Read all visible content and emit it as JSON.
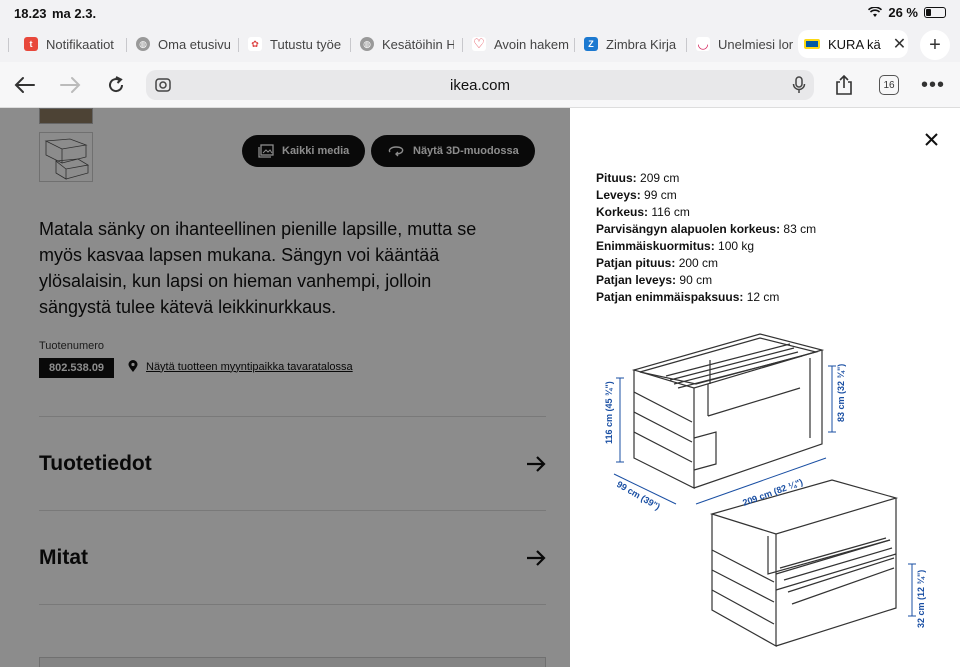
{
  "status": {
    "time": "18.23",
    "date": "ma 2.3.",
    "battery": "26 %",
    "battery_level": 0.26
  },
  "tabs": [
    {
      "label": "Notifikaatiot",
      "icon": "tori-icon",
      "color": "#e8483b"
    },
    {
      "label": "Oma etusivu",
      "icon": "globe-icon",
      "color": "#888888"
    },
    {
      "label": "Tutustu työe",
      "icon": "butterfly-icon",
      "color": "#d44"
    },
    {
      "label": "Kesätöihin H",
      "icon": "globe-icon",
      "color": "#888888"
    },
    {
      "label": "Avoin hakem",
      "icon": "heart-icon",
      "color": "#e03040"
    },
    {
      "label": "Zimbra Kirja",
      "icon": "zimbra-icon",
      "color": "#1c79d0"
    },
    {
      "label": "Unelmiesi lor",
      "icon": "smile-icon",
      "color": "#d6205a"
    },
    {
      "label": "KURA kä",
      "icon": "ikea-icon",
      "color": "#0058a3"
    }
  ],
  "address": {
    "url": "ikea.com"
  },
  "toolbar": {
    "tab_count": "16"
  },
  "page": {
    "media_button": "Kaikki media",
    "view3d_button": "Näytä 3D-muodossa",
    "description": "Matala sänky on ihanteellinen pienille lapsille, mutta se myös kasvaa lapsen mukana. Sängyn voi kääntää ylösalaisin, kun lapsi on hieman vanhempi, jolloin sängystä tulee kätevä leikkinurkkaus.",
    "product_number_label": "Tuotenumero",
    "product_number": "802.538.09",
    "store_link": "Näytä tuotteen myyntipaikka tavaratalossa",
    "sections": [
      {
        "title": "Tuotetiedot"
      },
      {
        "title": "Mitat"
      }
    ]
  },
  "panel": {
    "specs": [
      {
        "label": "Pituus:",
        "value": "209 cm"
      },
      {
        "label": "Leveys:",
        "value": "99 cm"
      },
      {
        "label": "Korkeus:",
        "value": "116 cm"
      },
      {
        "label": "Parvisängyn alapuolen korkeus:",
        "value": "83 cm"
      },
      {
        "label": "Enimmäiskuormitus:",
        "value": "100 kg"
      },
      {
        "label": "Patjan pituus:",
        "value": "200 cm"
      },
      {
        "label": "Patjan leveys:",
        "value": "90 cm"
      },
      {
        "label": "Patjan enimmäispaksuus:",
        "value": "12 cm"
      }
    ],
    "diagram_labels": {
      "height": "116 cm (45 ¾\")",
      "under": "83 cm (32 ¾\")",
      "width": "99 cm (39\")",
      "length": "209 cm (82 ¼\")",
      "low": "32 cm (12 ¾\")"
    }
  }
}
